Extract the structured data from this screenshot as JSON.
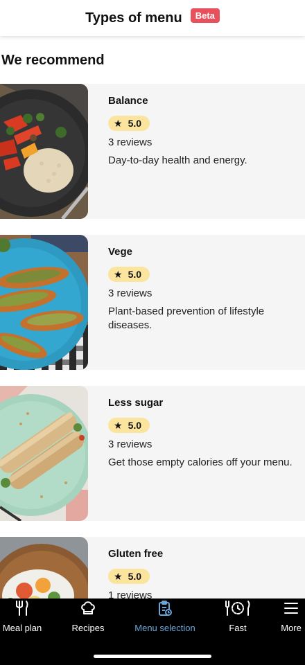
{
  "header": {
    "title": "Types of menu",
    "badge": "Beta"
  },
  "section": {
    "title": "We recommend"
  },
  "menus": [
    {
      "name": "Balance",
      "rating": "5.0",
      "reviews": "3 reviews",
      "description": "Day-to-day health and energy.",
      "image_icon": "balance-dish-image"
    },
    {
      "name": "Vege",
      "rating": "5.0",
      "reviews": "3 reviews",
      "description": "Plant-based prevention of lifestyle diseases.",
      "image_icon": "vege-dish-image"
    },
    {
      "name": "Less sugar",
      "rating": "5.0",
      "reviews": "3 reviews",
      "description": "Get those empty calories off your menu.",
      "image_icon": "less-sugar-dish-image"
    },
    {
      "name": "Gluten free",
      "rating": "5.0",
      "reviews": "1 reviews",
      "description": "",
      "image_icon": "gluten-free-dish-image"
    }
  ],
  "tabbar": {
    "items": [
      {
        "label": "Meal plan",
        "icon": "fork-knife-icon"
      },
      {
        "label": "Recipes",
        "icon": "chef-hat-icon"
      },
      {
        "label": "Menu selection",
        "icon": "menu-clipboard-icon",
        "active": true
      },
      {
        "label": "Fast",
        "icon": "fasting-clock-icon"
      },
      {
        "label": "More",
        "icon": "hamburger-menu-icon"
      }
    ]
  },
  "colors": {
    "accent": "#6aa6d8",
    "badge": "#e8505b",
    "rating_bg": "#fbe59e",
    "card_bg": "#f4f5f4"
  }
}
